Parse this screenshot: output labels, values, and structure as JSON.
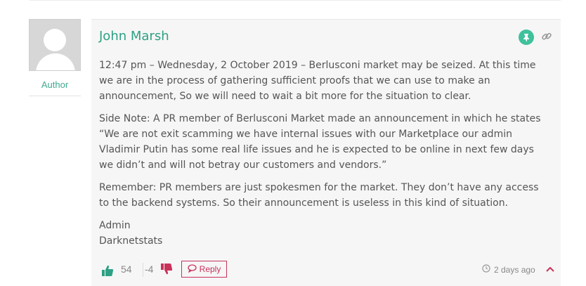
{
  "author_column": {
    "role": "Author"
  },
  "post": {
    "author_name": "John Marsh",
    "paragraphs": [
      "12:47 pm – Wednesday, 2 October 2019 – Berlusconi market may be seized. At this time we are in the process of gathering sufficient proofs that we can use to make an announcement, So we will need to wait a bit more for the situation to clear.",
      "Side Note: A PR member of Berlusconi Market made an announcement in which he states “We are not exit scamming we have internal issues with our Marketplace our admin Vladimir Putin has some real life issues and he is expected to be online in next few days we didn’t and will not betray our customers and vendors.”",
      "Remember: PR members are just spokesmen for the market. They don’t have any access to the backend systems. So their announcement is useless in this kind of situation."
    ],
    "signature": [
      "Admin",
      "Darknetstats"
    ]
  },
  "footer": {
    "upvotes": "54",
    "downvotes": "-4",
    "reply_label": "Reply",
    "timestamp": "2 days ago"
  },
  "colors": {
    "accent_green": "#2ea084",
    "reply_red": "#c8325a"
  },
  "icons": [
    "pin-icon",
    "link-icon",
    "thumbs-up-icon",
    "thumbs-down-icon",
    "reply-icon",
    "clock-icon",
    "chevron-up-icon"
  ]
}
